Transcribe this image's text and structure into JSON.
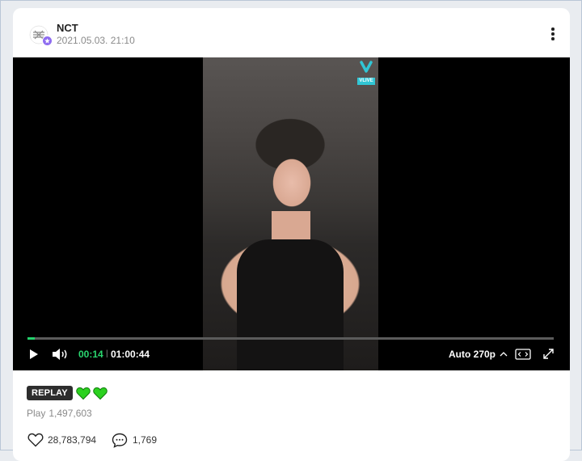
{
  "post": {
    "channel_name": "NCT",
    "date": "2021.05.03. 21:10",
    "more_icon": "more-vertical-icon"
  },
  "player": {
    "watermark": "VLIVE",
    "progress": 0.0035,
    "current_time": "00:14",
    "separator": "|",
    "total_time": "01:00:44",
    "quality": "Auto 270p",
    "accent_color": "#24d16c"
  },
  "meta": {
    "replay_label": "REPLAY",
    "play_label": "Play",
    "play_count": "1,497,603",
    "likes": "28,783,794",
    "comments": "1,769",
    "heart_color": "#2bd11f"
  }
}
